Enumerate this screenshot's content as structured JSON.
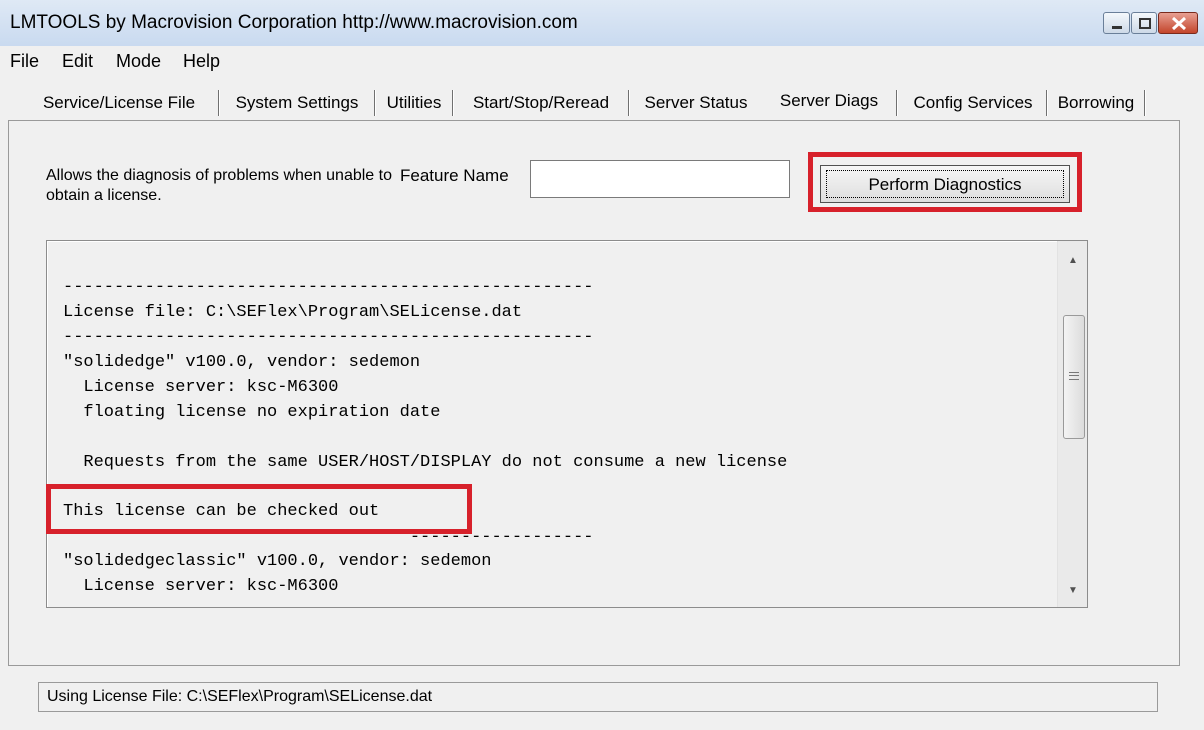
{
  "window": {
    "title": "LMTOOLS by Macrovision Corporation http://www.macrovision.com",
    "controls": {
      "minimize": "minimize-icon",
      "maximize": "maximize-icon",
      "close": "close-icon"
    }
  },
  "menu": {
    "items": [
      {
        "label": "File"
      },
      {
        "label": "Edit"
      },
      {
        "label": "Mode"
      },
      {
        "label": "Help"
      }
    ]
  },
  "tabs": [
    {
      "label": "Service/License File"
    },
    {
      "label": "System Settings"
    },
    {
      "label": "Utilities"
    },
    {
      "label": "Start/Stop/Reread"
    },
    {
      "label": "Server Status"
    },
    {
      "label": "Server Diags",
      "active": true
    },
    {
      "label": "Config Services"
    },
    {
      "label": "Borrowing"
    }
  ],
  "diag": {
    "description": "Allows the diagnosis of problems when unable to obtain a license.",
    "feature_label": "Feature Name",
    "feature_value": "",
    "button_label": "Perform Diagnostics"
  },
  "output": {
    "lines": [
      "----------------------------------------------------",
      "License file: C:\\SEFlex\\Program\\SELicense.dat",
      "----------------------------------------------------",
      "\"solidedge\" v100.0, vendor: sedemon",
      "  License server: ksc-M6300",
      "  floating license no expiration date",
      "",
      "  Requests from the same USER/HOST/DISPLAY do not consume a new license",
      "This license can be checked out",
      "                                  ------------------",
      "\"solidedgeclassic\" v100.0, vendor: sedemon",
      "  License server: ksc-M6300"
    ]
  },
  "status": {
    "text": "Using License File:  C:\\SEFlex\\Program\\SELicense.dat"
  },
  "colors": {
    "highlight": "#d7212b",
    "window_bg": "#f0f0f0"
  }
}
